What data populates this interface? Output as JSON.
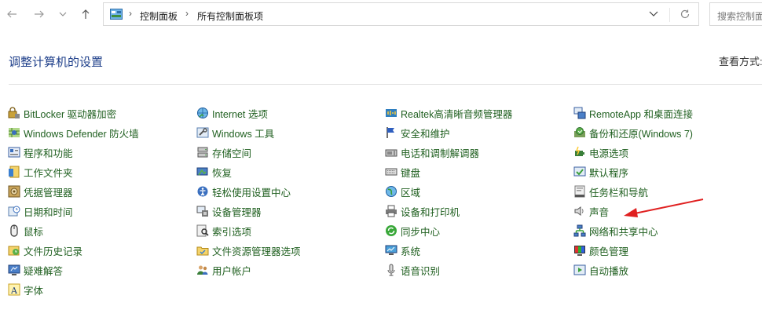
{
  "address": {
    "crumbs": [
      "控制面板",
      "所有控制面板项"
    ]
  },
  "search": {
    "placeholder": "搜索控制面"
  },
  "header": {
    "title": "调整计算机的设置",
    "view_label": "查看方式:"
  },
  "columns": [
    [
      {
        "label": "BitLocker 驱动器加密",
        "icon": "bitlocker-icon"
      },
      {
        "label": "Windows Defender 防火墙",
        "icon": "firewall-icon"
      },
      {
        "label": "程序和功能",
        "icon": "programs-icon"
      },
      {
        "label": "工作文件夹",
        "icon": "work-folders-icon"
      },
      {
        "label": "凭据管理器",
        "icon": "credential-icon"
      },
      {
        "label": "日期和时间",
        "icon": "datetime-icon"
      },
      {
        "label": "鼠标",
        "icon": "mouse-icon"
      },
      {
        "label": "文件历史记录",
        "icon": "file-history-icon"
      },
      {
        "label": "疑难解答",
        "icon": "troubleshoot-icon"
      },
      {
        "label": "字体",
        "icon": "font-icon"
      }
    ],
    [
      {
        "label": "Internet 选项",
        "icon": "internet-icon"
      },
      {
        "label": "Windows 工具",
        "icon": "tools-icon"
      },
      {
        "label": "存储空间",
        "icon": "storage-icon"
      },
      {
        "label": "恢复",
        "icon": "recovery-icon"
      },
      {
        "label": "轻松使用设置中心",
        "icon": "ease-of-access-icon"
      },
      {
        "label": "设备管理器",
        "icon": "device-manager-icon"
      },
      {
        "label": "索引选项",
        "icon": "indexing-icon"
      },
      {
        "label": "文件资源管理器选项",
        "icon": "folder-options-icon"
      },
      {
        "label": "用户帐户",
        "icon": "user-accounts-icon"
      }
    ],
    [
      {
        "label": "Realtek高清晰音频管理器",
        "icon": "realtek-audio-icon"
      },
      {
        "label": "安全和维护",
        "icon": "security-flag-icon"
      },
      {
        "label": "电话和调制解调器",
        "icon": "phone-modem-icon"
      },
      {
        "label": "键盘",
        "icon": "keyboard-icon"
      },
      {
        "label": "区域",
        "icon": "region-icon"
      },
      {
        "label": "设备和打印机",
        "icon": "printer-icon"
      },
      {
        "label": "同步中心",
        "icon": "sync-icon"
      },
      {
        "label": "系统",
        "icon": "system-icon"
      },
      {
        "label": "语音识别",
        "icon": "microphone-icon"
      }
    ],
    [
      {
        "label": "RemoteApp 和桌面连接",
        "icon": "remoteapp-icon"
      },
      {
        "label": "备份和还原(Windows 7)",
        "icon": "backup-icon"
      },
      {
        "label": "电源选项",
        "icon": "power-icon"
      },
      {
        "label": "默认程序",
        "icon": "default-programs-icon"
      },
      {
        "label": "任务栏和导航",
        "icon": "taskbar-icon"
      },
      {
        "label": "声音",
        "icon": "speaker-icon"
      },
      {
        "label": "网络和共享中心",
        "icon": "network-icon"
      },
      {
        "label": "颜色管理",
        "icon": "color-management-icon"
      },
      {
        "label": "自动播放",
        "icon": "autoplay-icon"
      }
    ]
  ],
  "colors": {
    "title": "#1e3f8a",
    "item_text": "#1f5f1f",
    "annotation_arrow": "#e02020"
  }
}
